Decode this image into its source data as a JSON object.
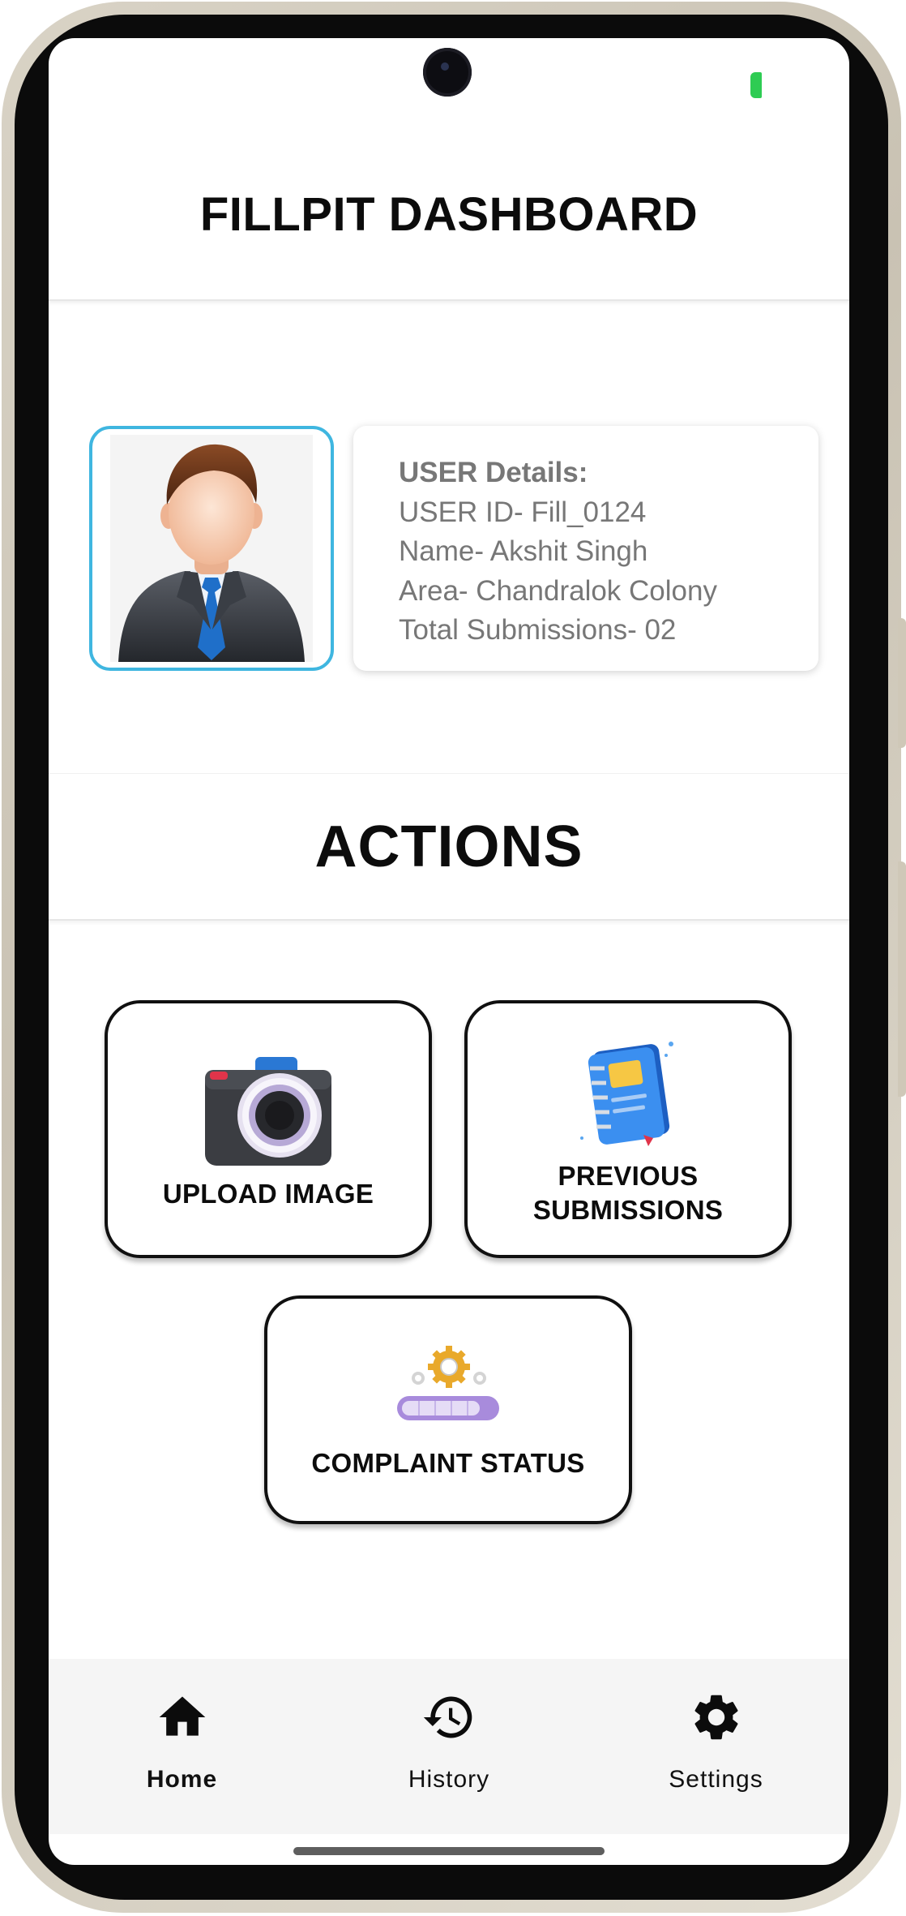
{
  "app": {
    "title": "FILLPIT DASHBOARD"
  },
  "user": {
    "details_title": "USER Details:",
    "user_id": "USER ID- Fill_0124",
    "name": "Name- Akshit Singh",
    "area": "Area- Chandralok Colony",
    "total_submissions": "Total Submissions- 02",
    "avatar_icon": "businessman-avatar-icon"
  },
  "actions": {
    "title": "ACTIONS",
    "items": [
      {
        "label": "UPLOAD IMAGE",
        "icon": "camera-icon"
      },
      {
        "label": "PREVIOUS\nSUBMISSIONS",
        "icon": "notebook-icon"
      },
      {
        "label": "COMPLAINT STATUS",
        "icon": "progress-gears-icon"
      }
    ]
  },
  "bottom_nav": {
    "active": "Home",
    "items": [
      {
        "label": "Home",
        "icon": "home-icon"
      },
      {
        "label": "History",
        "icon": "history-icon"
      },
      {
        "label": "Settings",
        "icon": "gear-icon"
      }
    ]
  },
  "colors": {
    "avatar_border": "#3fb6e0",
    "battery": "#2ecc53",
    "nav_background": "#f5f5f5",
    "text_muted": "#777777"
  }
}
